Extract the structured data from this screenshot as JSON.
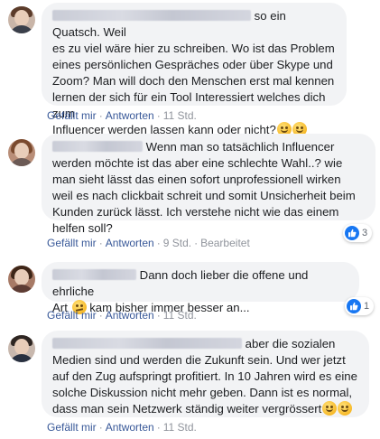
{
  "comments": [
    {
      "text_lines": [
        "so ein Quatsch. Weil",
        "es zu viel wäre hier zu schreiben. Wo ist das Problem",
        "eines persönlichen Gespräches oder über Skype und",
        "Zoom? Man will doch den Menschen erst mal kennen",
        "lernen der sich für ein Tool Interessiert welches dich zum",
        "Influencer werden lassen kann oder nicht?"
      ],
      "actions": {
        "like": "Gefällt mir",
        "reply": "Antworten",
        "time": "11 Std."
      }
    },
    {
      "text_lines": [
        "Wenn man so tatsächlich Influencer",
        "werden möchte ist das aber eine schlechte Wahl..? wie",
        "man sieht lässt das einen sofort unprofessionell wirken",
        "weil es nach clickbait schreit und somit Unsicherheit beim",
        "Kunden zurück lässt. Ich verstehe nicht wie das einem",
        "helfen soll?"
      ],
      "actions": {
        "like": "Gefällt mir",
        "reply": "Antworten",
        "time": "9 Std.",
        "edited": "Bearbeitet"
      },
      "reactions": "3"
    },
    {
      "text_lines": [
        "Dann doch lieber die offene und ehrliche",
        "Art",
        "kam bisher immer besser an..."
      ],
      "actions": {
        "like": "Gefällt mir",
        "reply": "Antworten",
        "time": "11 Std."
      },
      "reactions": "1"
    },
    {
      "text_lines": [
        "aber die sozialen",
        "Medien sind und werden die Zukunft sein. Und wer jetzt",
        "auf den Zug aufspringt profitiert. In 10 Jahren wird es eine",
        "solche Diskussion nicht mehr geben. Dann ist es normal,",
        "dass man sein Netzwerk ständig weiter vergrössert"
      ],
      "actions": {
        "like": "Gefällt mir",
        "reply": "Antworten",
        "time": "11 Std."
      }
    }
  ],
  "icons": {
    "avatar": "avatar-photo",
    "like": "thumbs-up-icon",
    "smile": "smiling-face-emoji",
    "confused": "confused-face-emoji"
  },
  "colors": {
    "bubble": "#f2f3f5",
    "link": "#385898",
    "like_blue": "#1877f2",
    "meta": "#606770"
  }
}
